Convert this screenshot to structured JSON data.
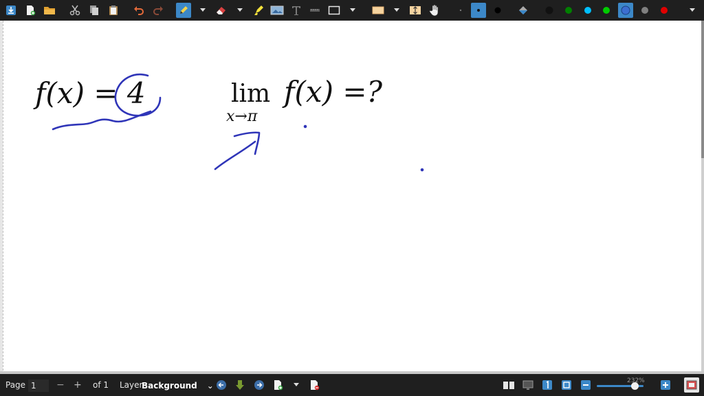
{
  "toolbar": {
    "colors": {
      "black": "#111111",
      "dark_green": "#008000",
      "cyan": "#00bfff",
      "green": "#00cc00",
      "blue_selected": "#3c6fd0",
      "gray": "#808080",
      "red": "#e00000",
      "accent": "#3c88c8"
    },
    "icons": [
      "download-icon",
      "new-page-icon",
      "open-folder-icon",
      "cut-icon",
      "copy-icon",
      "paste-icon",
      "undo-icon",
      "redo-icon",
      "pen-icon",
      "eraser-icon",
      "highlighter-icon",
      "image-icon",
      "text-icon",
      "ruler-icon",
      "rectangle-icon",
      "select-rect-icon",
      "vertical-space-icon",
      "hand-icon",
      "dot-icon",
      "fill-icon"
    ]
  },
  "canvas": {
    "math": {
      "left_expression": "f(x) = 4",
      "limit_word": "lim",
      "limit_subscript": "x→π",
      "right_expression": "f(x) =?"
    }
  },
  "statusbar": {
    "page_label": "Page",
    "page_value": "1",
    "minus_label": "−",
    "plus_label": "+",
    "of_label": "of 1",
    "layer_label": "Layer",
    "layer_value": "Background",
    "layer_chevron": "⌄",
    "zoom_label": "232%",
    "zoom_level": 0.82
  }
}
